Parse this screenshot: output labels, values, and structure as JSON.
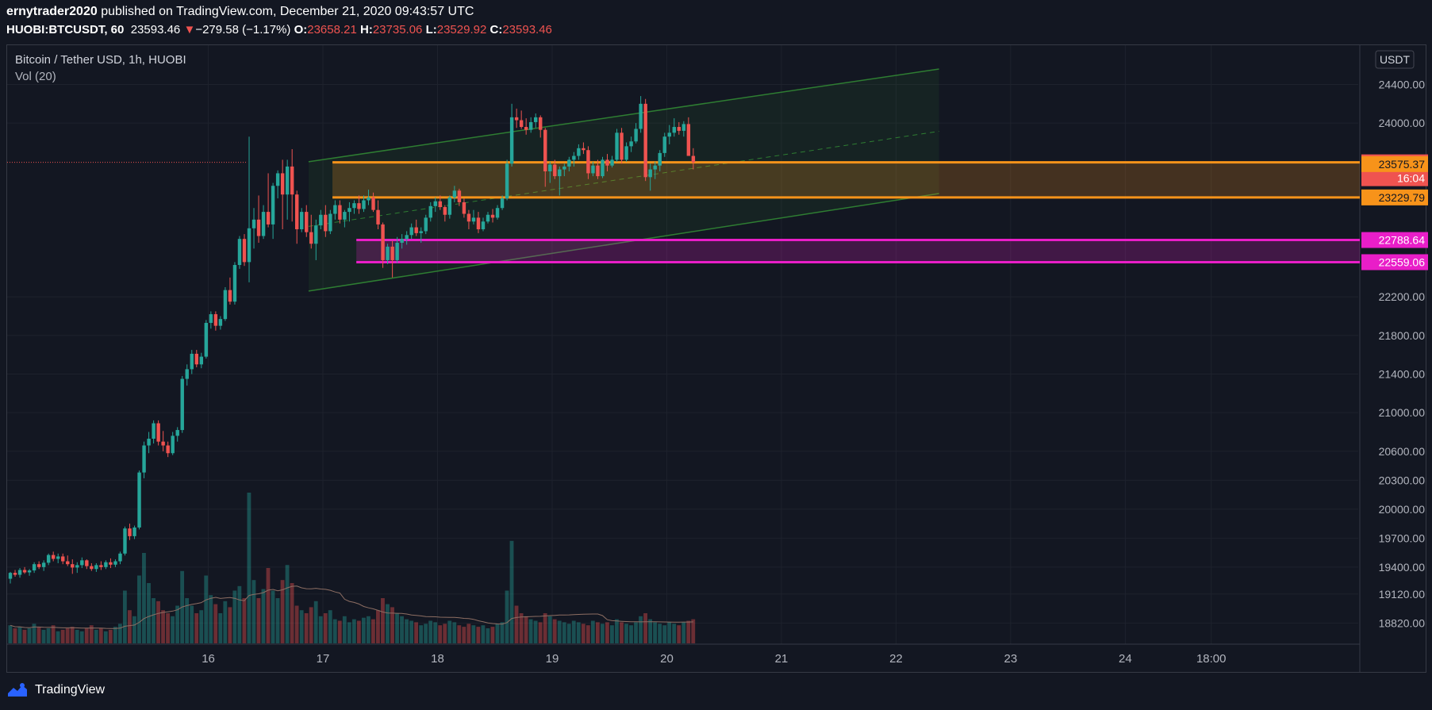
{
  "header": {
    "author": "ernytrader2020",
    "published": "published on TradingView.com, December 21, 2020 09:43:57 UTC",
    "symbol": "HUOBI:BTCUSDT, 60",
    "last": "23593.46",
    "change_arrow": "▼",
    "change": "−279.58 (−1.17%)",
    "o_label": "O:",
    "o": "23658.21",
    "h_label": "H:",
    "h": "23735.06",
    "l_label": "L:",
    "l": "23529.92",
    "c_label": "C:",
    "c": "23593.46"
  },
  "legend": {
    "title": "Bitcoin / Tether USD, 1h, HUOBI",
    "volume": "Vol (20)"
  },
  "currency_button": "USDT",
  "footer": {
    "brand": "TradingView",
    "logo_icon": "tradingview-logo-icon"
  },
  "colors": {
    "bg": "#131722",
    "grid": "#1e222d",
    "up": "#26a69a",
    "down": "#ef5350",
    "orange": "#f7931a",
    "magenta": "#e91ec8",
    "channel": "#2e7d32"
  },
  "chart_data": {
    "type": "candlestick",
    "ylim": [
      18700,
      24700
    ],
    "y_ticks": [
      {
        "v": 24400,
        "label": "24400.00"
      },
      {
        "v": 24000,
        "label": "24000.00"
      },
      {
        "v": 22200,
        "label": "22200.00"
      },
      {
        "v": 21800,
        "label": "21800.00"
      },
      {
        "v": 21400,
        "label": "21400.00"
      },
      {
        "v": 21000,
        "label": "21000.00"
      },
      {
        "v": 20600,
        "label": "20600.00"
      },
      {
        "v": 20300,
        "label": "20300.00"
      },
      {
        "v": 20000,
        "label": "20000.00"
      },
      {
        "v": 19700,
        "label": "19700.00"
      },
      {
        "v": 19400,
        "label": "19400.00"
      },
      {
        "v": 19120,
        "label": "19120.00"
      },
      {
        "v": 18820,
        "label": "18820.00"
      }
    ],
    "x_ticks": [
      {
        "label": "16",
        "bar": 27
      },
      {
        "label": "17",
        "bar": 51
      },
      {
        "label": "18",
        "bar": 75
      },
      {
        "label": "19",
        "bar": 99
      },
      {
        "label": "20",
        "bar": 123
      },
      {
        "label": "21",
        "bar": 147
      },
      {
        "label": "22",
        "bar": 171
      },
      {
        "label": "23",
        "bar": 195
      },
      {
        "label": "24",
        "bar": 219
      },
      {
        "label": "18:00",
        "bar": 237
      }
    ],
    "price_labels": [
      {
        "value": 23593.46,
        "label": "23593.46",
        "color": "#ef5350"
      },
      {
        "label": "16:04",
        "color": "#ef5350",
        "offset": 1
      },
      {
        "value": 23575.37,
        "label": "23575.37",
        "color": "#f7931a"
      },
      {
        "value": 23229.79,
        "label": "23229.79",
        "color": "#f7931a",
        "offset": 1
      },
      {
        "value": 22788.64,
        "label": "22788.64",
        "color": "#e91ec8"
      },
      {
        "value": 22559.06,
        "label": "22559.06",
        "color": "#e91ec8"
      }
    ],
    "zones": [
      {
        "name": "",
        "top": 23593.46,
        "bottom": 23229.79,
        "start_bar": 53,
        "color": "#f7931a"
      },
      {
        "name": "",
        "top": 22788.64,
        "bottom": 22559.06,
        "start_bar": 58,
        "color": "#e91ec8"
      }
    ],
    "channel": {
      "start_bar": 48,
      "end_bar": 180,
      "upper_start": 23600,
      "upper_end": 24560,
      "lower_start": 22260,
      "lower_end": 23270,
      "mid_start": 22930,
      "mid_end": 23915
    },
    "current_price": 23593.46,
    "candles": [
      [
        19279,
        19350,
        19230,
        19340
      ],
      [
        19340,
        19370,
        19300,
        19320
      ],
      [
        19320,
        19390,
        19290,
        19370
      ],
      [
        19370,
        19400,
        19330,
        19345
      ],
      [
        19345,
        19380,
        19310,
        19365
      ],
      [
        19365,
        19450,
        19340,
        19430
      ],
      [
        19430,
        19460,
        19380,
        19400
      ],
      [
        19400,
        19470,
        19360,
        19445
      ],
      [
        19445,
        19540,
        19420,
        19525
      ],
      [
        19525,
        19560,
        19460,
        19485
      ],
      [
        19485,
        19540,
        19440,
        19510
      ],
      [
        19510,
        19540,
        19430,
        19460
      ],
      [
        19460,
        19520,
        19410,
        19430
      ],
      [
        19430,
        19480,
        19330,
        19395
      ],
      [
        19395,
        19450,
        19340,
        19420
      ],
      [
        19420,
        19500,
        19390,
        19470
      ],
      [
        19470,
        19480,
        19380,
        19410
      ],
      [
        19410,
        19440,
        19360,
        19380
      ],
      [
        19380,
        19440,
        19350,
        19420
      ],
      [
        19420,
        19460,
        19370,
        19400
      ],
      [
        19400,
        19470,
        19380,
        19450
      ],
      [
        19450,
        19490,
        19390,
        19425
      ],
      [
        19425,
        19480,
        19400,
        19460
      ],
      [
        19460,
        19560,
        19430,
        19540
      ],
      [
        19540,
        19820,
        19520,
        19800
      ],
      [
        19800,
        19850,
        19680,
        19720
      ],
      [
        19720,
        19830,
        19690,
        19810
      ],
      [
        19810,
        20400,
        19790,
        20380
      ],
      [
        20380,
        20700,
        20320,
        20660
      ],
      [
        20660,
        20800,
        20580,
        20730
      ],
      [
        20730,
        20920,
        20680,
        20890
      ],
      [
        20890,
        20920,
        20660,
        20700
      ],
      [
        20700,
        20810,
        20600,
        20660
      ],
      [
        20660,
        20700,
        20540,
        20580
      ],
      [
        20580,
        20800,
        20560,
        20760
      ],
      [
        20760,
        20850,
        20700,
        20820
      ],
      [
        20820,
        21380,
        20790,
        21350
      ],
      [
        21350,
        21500,
        21280,
        21450
      ],
      [
        21450,
        21650,
        21400,
        21610
      ],
      [
        21610,
        21650,
        21470,
        21500
      ],
      [
        21500,
        21620,
        21460,
        21580
      ],
      [
        21580,
        21960,
        21560,
        21930
      ],
      [
        21930,
        22050,
        21870,
        22020
      ],
      [
        22020,
        22050,
        21850,
        21900
      ],
      [
        21900,
        22000,
        21860,
        21970
      ],
      [
        21970,
        22300,
        21950,
        22270
      ],
      [
        22270,
        22400,
        22120,
        22150
      ],
      [
        22150,
        22560,
        22120,
        22530
      ],
      [
        22530,
        22830,
        22490,
        22800
      ],
      [
        22800,
        22850,
        22520,
        22560
      ],
      [
        22560,
        23860,
        22350,
        22910
      ],
      [
        22910,
        23120,
        22700,
        23000
      ],
      [
        23000,
        23250,
        22760,
        22830
      ],
      [
        22830,
        23150,
        22800,
        23080
      ],
      [
        23080,
        23480,
        22920,
        22950
      ],
      [
        22950,
        23380,
        22800,
        23350
      ],
      [
        23350,
        23510,
        23220,
        23480
      ],
      [
        23480,
        23620,
        22900,
        23260
      ],
      [
        23260,
        23620,
        23000,
        23550
      ],
      [
        23550,
        23730,
        22980,
        23260
      ],
      [
        23260,
        23300,
        22750,
        22900
      ],
      [
        22900,
        23120,
        22870,
        23080
      ],
      [
        23080,
        23150,
        22820,
        22870
      ],
      [
        22870,
        23050,
        22700,
        22750
      ],
      [
        22750,
        23000,
        22580,
        22940
      ],
      [
        22940,
        23100,
        22900,
        23050
      ],
      [
        23050,
        23150,
        22820,
        22880
      ],
      [
        22880,
        23100,
        22850,
        23060
      ],
      [
        23060,
        23200,
        23000,
        23150
      ],
      [
        23150,
        23200,
        22960,
        23000
      ],
      [
        23000,
        23100,
        22920,
        23080
      ],
      [
        23080,
        23180,
        22980,
        23120
      ],
      [
        23120,
        23200,
        23060,
        23170
      ],
      [
        23170,
        23250,
        23060,
        23110
      ],
      [
        23110,
        23250,
        23080,
        23200
      ],
      [
        23200,
        23310,
        23150,
        23230
      ],
      [
        23230,
        23280,
        23080,
        23100
      ],
      [
        23100,
        23200,
        22900,
        22950
      ],
      [
        22950,
        22970,
        22500,
        22580
      ],
      [
        22580,
        22750,
        22540,
        22720
      ],
      [
        22720,
        22780,
        22400,
        22580
      ],
      [
        22580,
        22820,
        22550,
        22760
      ],
      [
        22760,
        22850,
        22700,
        22800
      ],
      [
        22800,
        22880,
        22740,
        22840
      ],
      [
        22840,
        22960,
        22800,
        22920
      ],
      [
        22920,
        23000,
        22830,
        22860
      ],
      [
        22860,
        22920,
        22760,
        22880
      ],
      [
        22880,
        23050,
        22850,
        23020
      ],
      [
        23020,
        23180,
        22980,
        23140
      ],
      [
        23140,
        23230,
        23080,
        23190
      ],
      [
        23190,
        23250,
        23100,
        23130
      ],
      [
        23130,
        23150,
        22980,
        23050
      ],
      [
        23050,
        23250,
        23010,
        23230
      ],
      [
        23230,
        23350,
        23180,
        23300
      ],
      [
        23300,
        23320,
        23140,
        23180
      ],
      [
        23180,
        23220,
        23020,
        23060
      ],
      [
        23060,
        23100,
        22900,
        22980
      ],
      [
        22980,
        23100,
        22950,
        23020
      ],
      [
        23020,
        23080,
        22860,
        22900
      ],
      [
        22900,
        23020,
        22880,
        22980
      ],
      [
        22980,
        23080,
        22960,
        23050
      ],
      [
        23050,
        23110,
        22970,
        23020
      ],
      [
        23020,
        23150,
        23000,
        23120
      ],
      [
        23120,
        23250,
        23100,
        23220
      ],
      [
        23220,
        23620,
        23200,
        23580
      ],
      [
        23580,
        24200,
        23550,
        24060
      ],
      [
        24060,
        24150,
        23950,
        24030
      ],
      [
        24030,
        24130,
        23940,
        23960
      ],
      [
        23960,
        24050,
        23880,
        23930
      ],
      [
        23930,
        24060,
        23900,
        24010
      ],
      [
        24010,
        24100,
        23950,
        24060
      ],
      [
        24060,
        24080,
        23850,
        23930
      ],
      [
        23930,
        23950,
        23340,
        23500
      ],
      [
        23500,
        23600,
        23380,
        23570
      ],
      [
        23570,
        23620,
        23420,
        23450
      ],
      [
        23450,
        23550,
        23250,
        23520
      ],
      [
        23520,
        23580,
        23450,
        23550
      ],
      [
        23550,
        23650,
        23500,
        23620
      ],
      [
        23620,
        23700,
        23550,
        23660
      ],
      [
        23660,
        23780,
        23620,
        23740
      ],
      [
        23740,
        23800,
        23680,
        23720
      ],
      [
        23720,
        23760,
        23420,
        23480
      ],
      [
        23480,
        23600,
        23450,
        23560
      ],
      [
        23560,
        23620,
        23420,
        23450
      ],
      [
        23450,
        23650,
        23430,
        23620
      ],
      [
        23620,
        23680,
        23500,
        23560
      ],
      [
        23560,
        23660,
        23540,
        23620
      ],
      [
        23620,
        23940,
        23600,
        23900
      ],
      [
        23900,
        23950,
        23580,
        23620
      ],
      [
        23620,
        23800,
        23600,
        23760
      ],
      [
        23760,
        23860,
        23700,
        23810
      ],
      [
        23810,
        24000,
        23790,
        23940
      ],
      [
        23940,
        24280,
        23900,
        24200
      ],
      [
        24200,
        24250,
        23400,
        23440
      ],
      [
        23440,
        23580,
        23300,
        23520
      ],
      [
        23520,
        23600,
        23420,
        23560
      ],
      [
        23560,
        23720,
        23500,
        23690
      ],
      [
        23690,
        23900,
        23650,
        23860
      ],
      [
        23860,
        23980,
        23780,
        23900
      ],
      [
        23900,
        24050,
        23860,
        23960
      ],
      [
        23960,
        24010,
        23880,
        23920
      ],
      [
        23920,
        24020,
        23860,
        23990
      ],
      [
        23990,
        24060,
        23900,
        23660
      ],
      [
        23660,
        23740,
        23520,
        23593
      ]
    ],
    "volumes": [
      0.12,
      0.1,
      0.11,
      0.09,
      0.1,
      0.13,
      0.11,
      0.09,
      0.1,
      0.12,
      0.08,
      0.09,
      0.1,
      0.11,
      0.09,
      0.08,
      0.1,
      0.12,
      0.09,
      0.1,
      0.08,
      0.09,
      0.11,
      0.13,
      0.35,
      0.22,
      0.18,
      0.45,
      0.6,
      0.4,
      0.3,
      0.28,
      0.22,
      0.2,
      0.18,
      0.25,
      0.48,
      0.3,
      0.25,
      0.2,
      0.22,
      0.45,
      0.32,
      0.26,
      0.2,
      0.28,
      0.24,
      0.35,
      0.38,
      0.3,
      1.0,
      0.42,
      0.3,
      0.36,
      0.5,
      0.35,
      0.3,
      0.42,
      0.52,
      0.4,
      0.25,
      0.22,
      0.2,
      0.24,
      0.28,
      0.18,
      0.2,
      0.22,
      0.16,
      0.15,
      0.18,
      0.14,
      0.16,
      0.15,
      0.17,
      0.18,
      0.16,
      0.22,
      0.3,
      0.26,
      0.24,
      0.2,
      0.18,
      0.16,
      0.15,
      0.14,
      0.12,
      0.13,
      0.15,
      0.14,
      0.12,
      0.13,
      0.15,
      0.14,
      0.12,
      0.11,
      0.13,
      0.12,
      0.11,
      0.12,
      0.1,
      0.11,
      0.13,
      0.14,
      0.35,
      0.68,
      0.25,
      0.2,
      0.18,
      0.16,
      0.15,
      0.14,
      0.2,
      0.18,
      0.16,
      0.15,
      0.14,
      0.13,
      0.15,
      0.14,
      0.13,
      0.12,
      0.15,
      0.14,
      0.13,
      0.14,
      0.12,
      0.16,
      0.14,
      0.13,
      0.12,
      0.14,
      0.18,
      0.2,
      0.16,
      0.14,
      0.13,
      0.12,
      0.14,
      0.13,
      0.12,
      0.14,
      0.15,
      0.16
    ],
    "volume_ma": 0.22
  }
}
